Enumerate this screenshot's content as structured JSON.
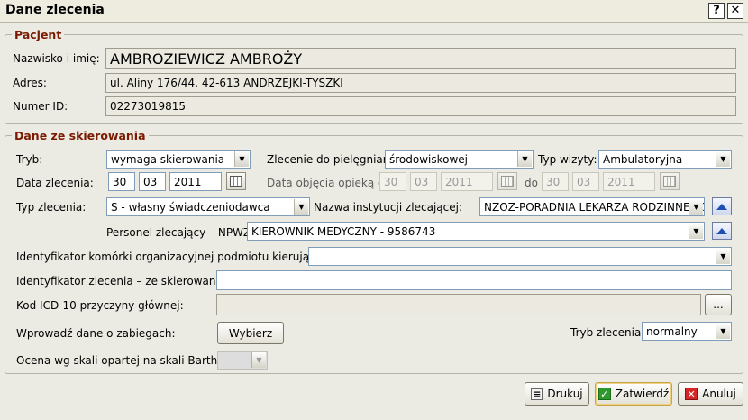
{
  "window": {
    "title": "Dane zlecenia",
    "help_label": "?",
    "close_label": "✕"
  },
  "patient": {
    "legend": "Pacjent",
    "name_label": "Nazwisko i imię:",
    "name_value": "AMBROZIEWICZ AMBROŻY",
    "address_label": "Adres:",
    "address_value": "ul. Aliny 176/44, 42-613 ANDRZEJKI-TYSZKI",
    "id_label": "Numer ID:",
    "id_value": "02273019815"
  },
  "referral": {
    "legend": "Dane ze skierowania",
    "mode_label": "Tryb:",
    "mode_value": "wymaga skierowania",
    "nurse_order_label": "Zlecenie do pielęgniarki:",
    "nurse_order_value": "środowiskowej",
    "visit_type_label": "Typ wizyty:",
    "visit_type_value": "Ambulatoryjna",
    "order_date_label": "Data zlecenia:",
    "order_date": {
      "day": "30",
      "month": "03",
      "year": "2011"
    },
    "care_from_label": "Data objęcia opieką od",
    "care_from": {
      "day": "30",
      "month": "03",
      "year": "2011"
    },
    "care_to_label": "do",
    "care_to": {
      "day": "30",
      "month": "03",
      "year": "2011"
    },
    "order_type_label": "Typ zlecenia:",
    "order_type_value": "S - własny świadczeniodawca",
    "institution_label": "Nazwa instytucji zlecającej:",
    "institution_value": "NZOZ-PORADNIA LEKARZA RODZINNEGO",
    "staff_label": "Personel zlecający – NPWZ:",
    "staff_value": "KIEROWNIK MEDYCZNY - 9586743",
    "unit_id_label": "Identyfikator komórki organizacyjnej podmiotu kierującego:",
    "unit_id_value": "",
    "order_id_label": "Identyfikator zlecenia – ze skierowania:",
    "order_id_value": "",
    "icd_label": "Kod ICD-10 przyczyny głównej:",
    "icd_value": "",
    "icd_button": "...",
    "procedures_label": "Wprowadź dane o zabiegach:",
    "procedures_button": "Wybierz",
    "order_mode_label": "Tryb zlecenia:",
    "order_mode_value": "normalny",
    "barthel_label": "Ocena wg skali opartej na skali Barthel:",
    "barthel_value": ""
  },
  "footer": {
    "print": "Drukuj",
    "confirm": "Zatwierdź",
    "cancel": "Anuluj"
  }
}
